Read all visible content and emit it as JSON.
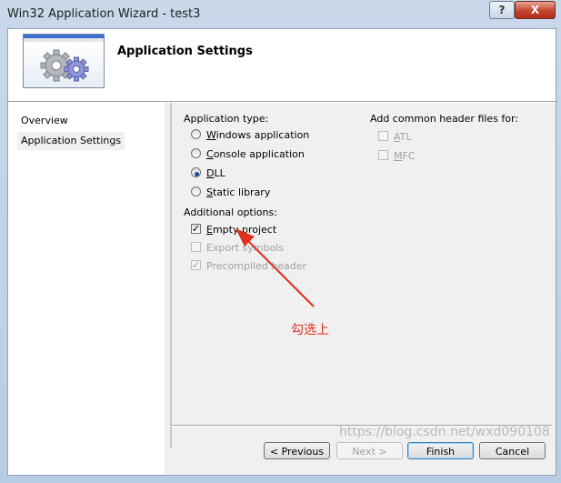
{
  "window": {
    "title": "Win32 Application Wizard - test3",
    "help_label": "?",
    "close_label": "X"
  },
  "header": {
    "title": "Application Settings"
  },
  "nav": {
    "items": [
      {
        "label": "Overview",
        "selected": false
      },
      {
        "label": "Application Settings",
        "selected": true
      }
    ]
  },
  "app_type": {
    "label": "Application type:",
    "options": [
      {
        "pre": "",
        "u": "W",
        "post": "indows application",
        "checked": false
      },
      {
        "pre": "",
        "u": "C",
        "post": "onsole application",
        "checked": false
      },
      {
        "pre": "",
        "u": "D",
        "post": "LL",
        "checked": true
      },
      {
        "pre": "",
        "u": "S",
        "post": "tatic library",
        "checked": false
      }
    ]
  },
  "additional": {
    "label": "Additional options:",
    "options": [
      {
        "pre": "",
        "u": "E",
        "post": "mpty project",
        "checked": true,
        "enabled": true
      },
      {
        "pre": "",
        "u": "",
        "post": "Export symbols",
        "checked": false,
        "enabled": false
      },
      {
        "pre": "",
        "u": "",
        "post": "Precompiled header",
        "checked": true,
        "enabled": false
      }
    ]
  },
  "headers": {
    "label": "Add common header files for:",
    "options": [
      {
        "pre": "",
        "u": "A",
        "post": "TL",
        "checked": false,
        "enabled": false
      },
      {
        "pre": "",
        "u": "M",
        "post": "FC",
        "checked": false,
        "enabled": false
      }
    ]
  },
  "annotation": {
    "text": "勾选上",
    "color": "#e03020"
  },
  "buttons": {
    "previous": "< Previous",
    "next": "Next >",
    "finish": "Finish",
    "cancel": "Cancel"
  },
  "watermark": "https://blog.csdn.net/wxd090108"
}
